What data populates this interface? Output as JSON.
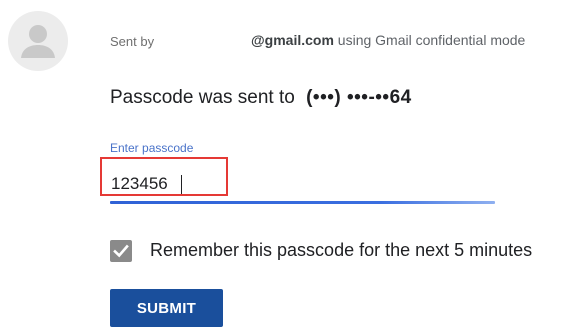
{
  "header": {
    "sent_by_label": "Sent by",
    "sender_email": "@gmail.com",
    "mode_text": "using Gmail confidential mode"
  },
  "message": {
    "text": "Passcode was sent to",
    "phone": "(•••) •••-••64"
  },
  "passcode_field": {
    "label": "Enter passcode",
    "value": "123456"
  },
  "remember": {
    "checked": true,
    "label": "Remember this passcode for the next 5 minutes"
  },
  "submit": {
    "label": "SUBMIT"
  },
  "colors": {
    "accent": "#1a4f9c",
    "field_underline": "#2f62d6",
    "label_blue": "#4a73c9",
    "highlight_box": "#e53935"
  },
  "icons": {
    "avatar": "person-icon",
    "checkbox": "check-icon"
  }
}
